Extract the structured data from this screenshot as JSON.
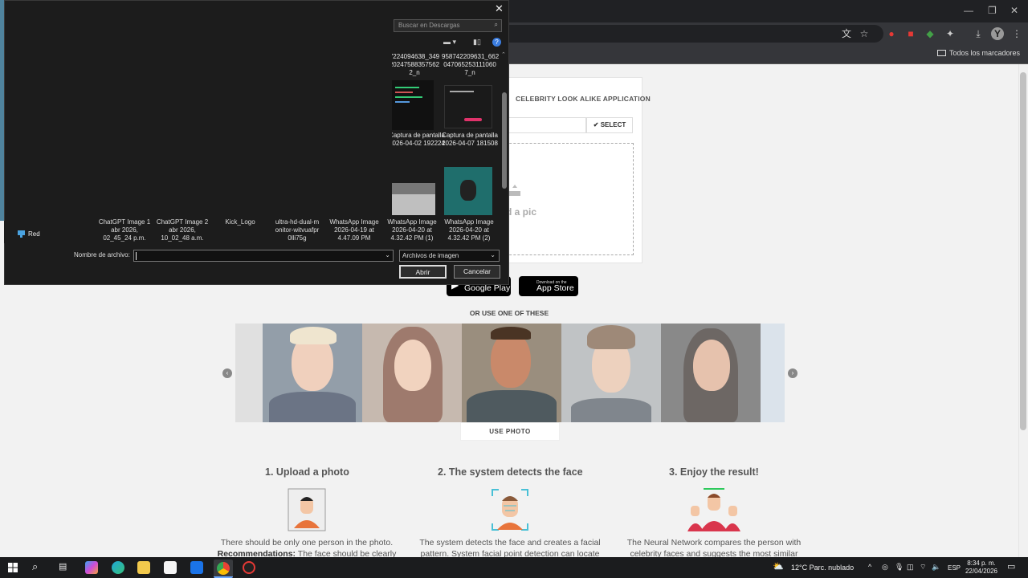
{
  "browser": {
    "bookmarks_all": "Todos los marcadores"
  },
  "page": {
    "app_title": "CELEBRITY LOOK ALIKE APPLICATION",
    "select_button": "SELECT",
    "drop_text": "d a pic",
    "google_play": {
      "small": "",
      "big": "Google Play"
    },
    "app_store": {
      "small": "Download on the",
      "big": "App Store"
    },
    "or_use": "OR USE ONE OF THESE",
    "use_photo": "USE PHOTO",
    "steps": [
      {
        "title": "1. Upload a photo",
        "desc": "There should be only one person in the photo.",
        "rec_label": "Recommendations:",
        "rec_text": "The face should be clearly"
      },
      {
        "title": "2. The system detects the face",
        "desc": "The system detects the face and creates a facial pattern. System facial point detection can locate"
      },
      {
        "title": "3. Enjoy the result!",
        "desc": "The Neural Network compares the person with celebrity faces and suggests the most similar"
      }
    ]
  },
  "dialog": {
    "search_placeholder": "Buscar en Descargas",
    "files_top": [
      {
        "name": "7224094638_349 20247588357562 2_n"
      },
      {
        "name": "958742209631_662 047065253111060 7_n"
      }
    ],
    "files_mid": [
      {
        "name": "Captura de pantalla 2026-04-02 192224"
      },
      {
        "name": "Captura de pantalla 2026-04-07 181508"
      }
    ],
    "files_bottom": [
      {
        "name": "ChatGPT Image 1 abr 2026, 02_45_24 p.m."
      },
      {
        "name": "ChatGPT Image 2 abr 2026, 10_02_48 a.m."
      },
      {
        "name": "Kick_Logo"
      },
      {
        "name": "ultra-hd-dual-m onitor-witvuafpr 0lli75g"
      },
      {
        "name": "WhatsApp Image 2026-04-19 at 4.47.09 PM"
      },
      {
        "name": "WhatsApp Image 2026-04-20 at 4.32.42 PM (1)"
      },
      {
        "name": "WhatsApp Image 2026-04-20 at 4.32.42 PM (2)"
      }
    ],
    "nav_network": "Red",
    "filename_label": "Nombre de archivo:",
    "filename_value": "",
    "filetype": "Archivos de imagen",
    "open_button": "Abrir",
    "cancel_button": "Cancelar"
  },
  "taskbar": {
    "weather": "12°C  Parc. nublado",
    "lang": "ESP",
    "time": "8:34 p. m.",
    "date": "22/04/2026"
  }
}
